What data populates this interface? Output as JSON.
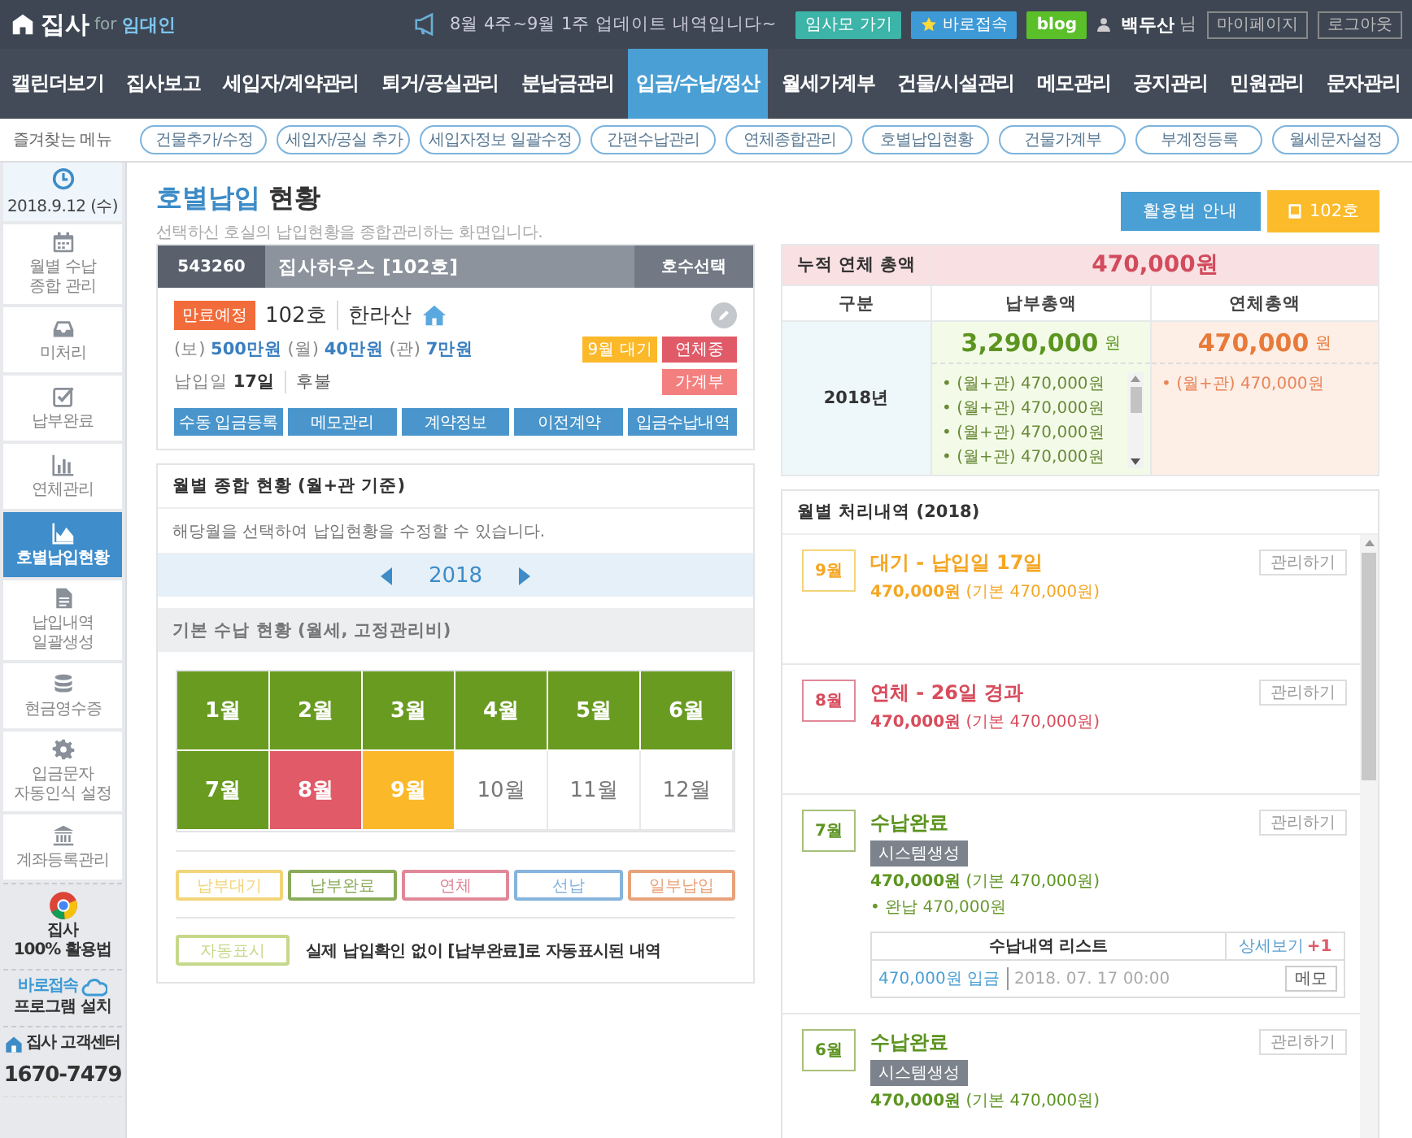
{
  "header": {
    "logo": "집사",
    "logo_for": "for",
    "logo_role": "임대인",
    "notice": "8월 4주~9월 1주 업데이트 내역입니다~",
    "buttons": [
      {
        "label": "임사모 가기",
        "kind": "teal"
      },
      {
        "label": "바로접속",
        "kind": "star"
      },
      {
        "label": "blog",
        "kind": "blog"
      }
    ],
    "user": "백두산",
    "user_suffix": "님",
    "links": [
      "마이페이지",
      "로그아웃"
    ]
  },
  "nav": [
    {
      "label": "캘린더보기",
      "selected": false
    },
    {
      "label": "집사보고",
      "selected": false
    },
    {
      "label": "세입자/계약관리",
      "selected": false
    },
    {
      "label": "퇴거/공실관리",
      "selected": false
    },
    {
      "label": "분납금관리",
      "selected": false
    },
    {
      "label": "입금/수납/정산",
      "selected": true
    },
    {
      "label": "월세가계부",
      "selected": false
    },
    {
      "label": "건물/시설관리",
      "selected": false
    },
    {
      "label": "메모관리",
      "selected": false
    },
    {
      "label": "공지관리",
      "selected": false
    },
    {
      "label": "민원관리",
      "selected": false
    },
    {
      "label": "문자관리",
      "selected": false
    }
  ],
  "quick_menu": {
    "label": "즐겨찾는 메뉴",
    "items": [
      "건물추가/수정",
      "세입자/공실 추가",
      "세입자정보 일괄수정",
      "간편수납관리",
      "연체종합관리",
      "호별납입현황",
      "건물가계부",
      "부계정등록",
      "월세문자설정"
    ]
  },
  "sidebar": {
    "date": "2018.9.12 (수)",
    "items": [
      {
        "kind": "calendar",
        "lines": [
          "월별 수납",
          "종합 관리"
        ],
        "selected": false
      },
      {
        "kind": "inbox",
        "lines": [
          "미처리"
        ],
        "selected": false
      },
      {
        "kind": "check",
        "lines": [
          "납부완료"
        ],
        "selected": false
      },
      {
        "kind": "bars",
        "lines": [
          "연체관리"
        ],
        "selected": false
      },
      {
        "kind": "area",
        "lines": [
          "호별납입현황"
        ],
        "selected": true
      },
      {
        "kind": "document",
        "lines": [
          "납입내역",
          "일괄생성"
        ],
        "selected": false
      },
      {
        "kind": "coins",
        "lines": [
          "현금영수증"
        ],
        "selected": false
      },
      {
        "kind": "gear",
        "lines": [
          "입금문자",
          "자동인식 설정"
        ],
        "selected": false
      },
      {
        "kind": "bank",
        "lines": [
          "계좌등록관리"
        ],
        "selected": false
      }
    ],
    "promos": [
      {
        "kind": "guide",
        "lines": [
          "집사",
          "100% 활용법"
        ]
      },
      {
        "kind": "remote",
        "lines": [
          "바로접속",
          "프로그램 설치"
        ]
      },
      {
        "kind": "support",
        "lines": [
          "집사 고객센터",
          "1670-7479"
        ]
      }
    ]
  },
  "page": {
    "title_highlight": "호별납입",
    "title_rest": "현황",
    "subtitle": "선택하신 호실의 납입현황을 종합관리하는 화면입니다.",
    "guide_button": "활용법 안내",
    "unit_button": "102호"
  },
  "unit_card": {
    "code": "543260",
    "name": "집사하우스 [102호]",
    "select": "호수선택",
    "status": "만료예정",
    "unit": "102호",
    "tenant": "한라산",
    "terms": "(보) **500만원** (월) **40만원** (관) **7만원**",
    "due": "납입일 **17일**",
    "payment": "후불",
    "tags": [
      {
        "label": "9월 대기",
        "color": "#fbb829"
      },
      {
        "label": "연체중",
        "color": "#e05a68"
      },
      {
        "label": "가계부",
        "color": "#f47f7f"
      }
    ],
    "actions": [
      "수동 입금등록",
      "메모관리",
      "계약정보",
      "이전계약",
      "입금수납내역"
    ]
  },
  "arrears": {
    "total_label": "누적 연체 총액",
    "total": "470,000원",
    "columns": [
      "구분",
      "납부총액",
      "연체총액"
    ],
    "row": {
      "year": "2018년",
      "paid": "3,290,000",
      "paid_unit": "원",
      "paid_items": [
        "• (월+관) 470,000원",
        "• (월+관) 470,000원",
        "• (월+관) 470,000원",
        "• (월+관) 470,000원"
      ],
      "overdue": "470,000",
      "overdue_unit": "원",
      "overdue_items": [
        "• (월+관) 470,000원"
      ]
    }
  },
  "monthly": {
    "title": "월별 종합 현황 (월+관 기준)",
    "hint": "해당월을 선택하여 납입현황을 수정할 수 있습니다.",
    "year": "2018",
    "section": "기본 수납 현황 (월세, 고정관리비)",
    "months": [
      {
        "label": "1월",
        "kind": "paid"
      },
      {
        "label": "2월",
        "kind": "paid"
      },
      {
        "label": "3월",
        "kind": "paid"
      },
      {
        "label": "4월",
        "kind": "paid"
      },
      {
        "label": "5월",
        "kind": "paid"
      },
      {
        "label": "6월",
        "kind": "paid"
      },
      {
        "label": "7월",
        "kind": "paid"
      },
      {
        "label": "8월",
        "kind": "overdue"
      },
      {
        "label": "9월",
        "kind": "waiting"
      },
      {
        "label": "10월",
        "kind": "none"
      },
      {
        "label": "11월",
        "kind": "none"
      },
      {
        "label": "12월",
        "kind": "none"
      }
    ],
    "legend": [
      {
        "label": "납부대기",
        "color": "#f2d57a"
      },
      {
        "label": "납부완료",
        "color": "#8aab5a"
      },
      {
        "label": "연체",
        "color": "#e08898"
      },
      {
        "label": "선납",
        "color": "#86b4dc"
      },
      {
        "label": "일부납입",
        "color": "#e8a27a"
      }
    ],
    "auto_mark": {
      "label": "자동표시",
      "color": "#c6d88a",
      "description": "실제 납입확인 없이 [납부완료]로 자동표시된 내역"
    }
  },
  "history": {
    "title": "월별 처리내역 (2018)",
    "items": [
      {
        "month": "9월",
        "kind": "waiting",
        "title": "대기 - 납입일 17일",
        "amount": "**470,000원** (기본 470,000원)",
        "action": "관리하기"
      },
      {
        "month": "8월",
        "kind": "overdue",
        "title": "연체 - 26일 경과",
        "amount": "**470,000원** (기본 470,000원)",
        "action": "관리하기"
      },
      {
        "month": "7월",
        "kind": "paid",
        "title": "수납완료",
        "badge": "시스템생성",
        "amount": "**470,000원** (기본 470,000원)",
        "note": "• 완납 470,000원",
        "receipts": {
          "title": "수납내역 리스트",
          "link": "상세보기",
          "count": "+1",
          "entries": [
            {
              "amount": "470,000원 입금",
              "date": "2018. 07. 17 00:00",
              "memo": "메모"
            }
          ]
        },
        "action": "관리하기"
      },
      {
        "month": "6월",
        "kind": "paid",
        "title": "수납완료",
        "badge": "시스템생성",
        "amount": "**470,000원** (기본 470,000원)",
        "action": "관리하기"
      }
    ]
  }
}
